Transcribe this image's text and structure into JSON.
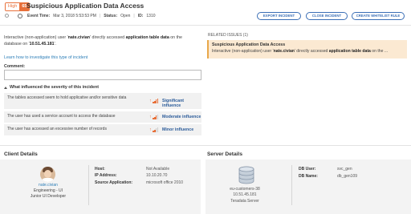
{
  "header": {
    "severity_label": "High",
    "severity_score": "65",
    "title": "Suspicious Application Data Access",
    "event_time_label": "Event Time:",
    "event_time_value": "Mar 3, 2018 5:53:53 PM",
    "status_label": "Status:",
    "status_value": "Open",
    "id_label": "ID:",
    "id_value": "1310",
    "buttons": {
      "export": "EXPORT INCIDENT",
      "close": "CLOSE INCIDENT",
      "whitelist": "CREATE WHITELIST RULE"
    }
  },
  "description": {
    "prefix": "Interactive (non-application) user '",
    "user": "nate.civian",
    "mid1": "' directly accessed ",
    "target": "application table data",
    "mid2": " on the database on '",
    "ip": "10.51.45.181",
    "suffix": "'."
  },
  "learn_link": "Learn how to investigate this type of incident",
  "comment": {
    "label": "Comment:",
    "value": "",
    "placeholder": ""
  },
  "influence": {
    "heading": "What influenced the severity of this incident",
    "rows": [
      {
        "text": "The tables accessed seem to hold applicative and/or sensitive data",
        "level": 3,
        "label": "Significant influence"
      },
      {
        "text": "The user has used a service account to access the database",
        "level": 2,
        "label": "Moderate influence"
      },
      {
        "text": "The user has accessed an excessive number of records",
        "level": 1,
        "label": "Minor influence"
      }
    ]
  },
  "related": {
    "heading": "RELATED ISSUES (1)",
    "title": "Suspicious Application Data Access",
    "prefix": "Interactive (non-application) user '",
    "user": "nate.civian",
    "mid": "' directly accessed ",
    "target": "application table data",
    "suffix": " on the ..."
  },
  "client": {
    "section_title": "Client Details",
    "user_name": "nate.civian",
    "dept": "Engineering - UI",
    "role": "Junior UI Developer",
    "host_label": "Host:",
    "host_value": "Not Available",
    "ip_label": "IP Address:",
    "ip_value": "10.10.20.70",
    "app_label": "Source Application:",
    "app_value": "microsoft office 2010"
  },
  "server": {
    "section_title": "Server Details",
    "name": "eu-customers-38",
    "ip": "10.51.45.181",
    "type": "Teradata Server",
    "db_user_label": "DB User:",
    "db_user_value": "svc_gen",
    "db_name_label": "DB Name:",
    "db_name_value": "db_gen109"
  },
  "colors": {
    "accent_orange": "#e8703a",
    "link_blue": "#2e7fb8",
    "button_blue": "#3b6fb6",
    "related_bg": "#fbe9d2"
  }
}
